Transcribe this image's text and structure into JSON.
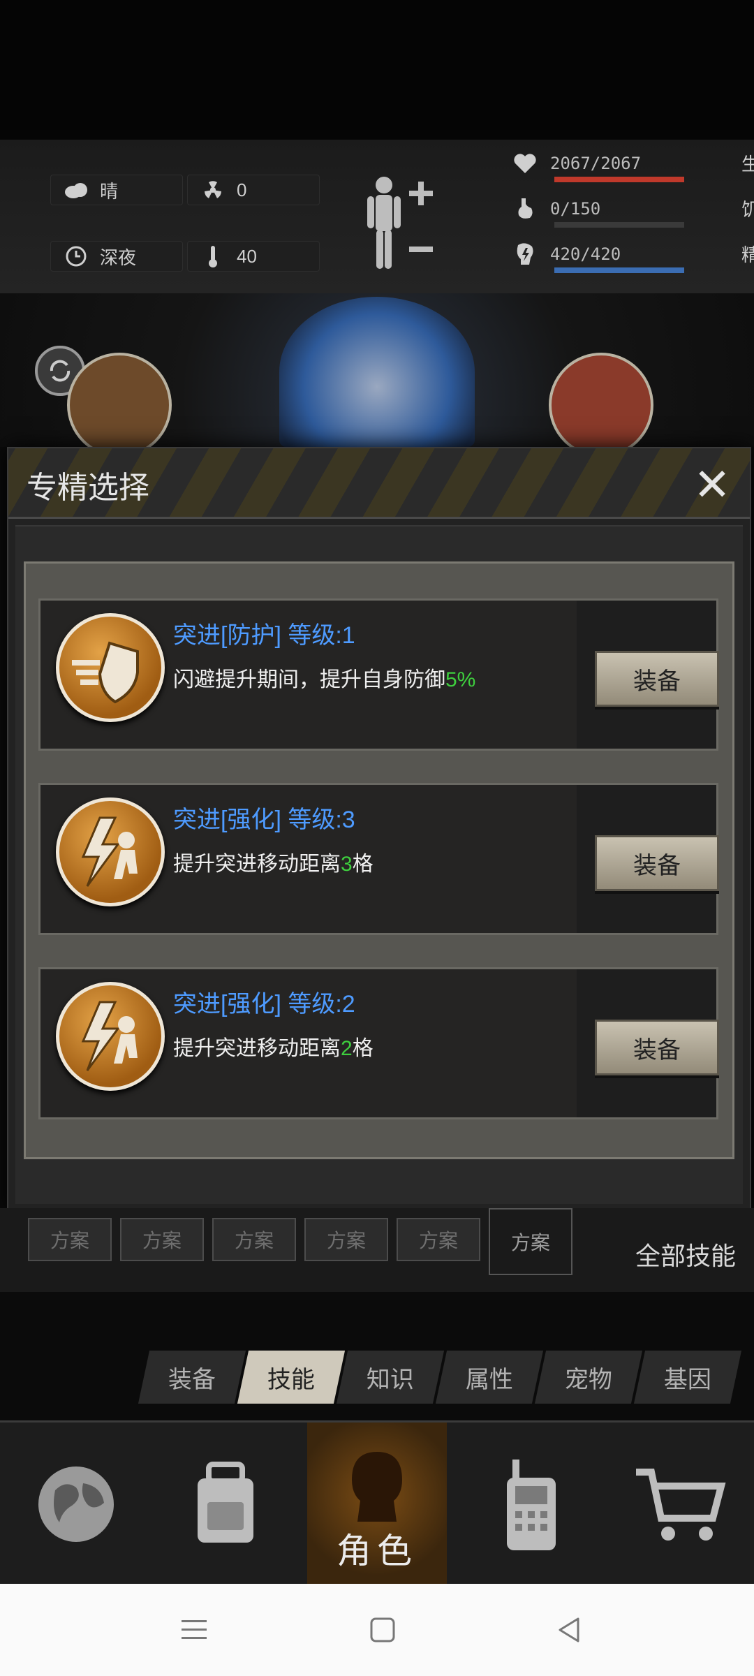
{
  "status": {
    "weather": "晴",
    "radiation": "0",
    "time_of_day": "深夜",
    "temperature": "40",
    "hp": {
      "value": "2067/2067",
      "label": "生命",
      "fill": 1.0,
      "color": "#c0392b"
    },
    "hunger": {
      "value": "0/150",
      "label": "饥饿",
      "fill": 0.0,
      "color": "#777777"
    },
    "energy": {
      "value": "420/420",
      "label": "精力",
      "fill": 1.0,
      "color": "#3b6db3"
    }
  },
  "modal": {
    "title": "专精选择",
    "close_symbol": "✕",
    "cards": [
      {
        "title": "突进[防护] 等级:1",
        "desc_pre": "闪避提升期间，提升自身防御",
        "desc_highlight": "5%",
        "desc_post": "",
        "button": "装备",
        "icon": "dash-shield-icon"
      },
      {
        "title": "突进[强化] 等级:3",
        "desc_pre": "提升突进移动距离",
        "desc_highlight": "3",
        "desc_post": "格",
        "button": "装备",
        "icon": "dash-lightning-icon"
      },
      {
        "title": "突进[强化] 等级:2",
        "desc_pre": "提升突进移动距离",
        "desc_highlight": "2",
        "desc_post": "格",
        "button": "装备",
        "icon": "dash-lightning-icon"
      }
    ]
  },
  "plans": {
    "labels": [
      "方案",
      "方案",
      "方案",
      "方案",
      "方案",
      "方案"
    ],
    "all_skills": "全部技能"
  },
  "tabs": [
    "装备",
    "技能",
    "知识",
    "属性",
    "宠物",
    "基因"
  ],
  "active_tab": "技能",
  "nav": {
    "items": [
      "globe-icon",
      "backpack-icon",
      "character-icon",
      "walkie-talkie-icon",
      "cart-icon"
    ],
    "active_label": "角色"
  }
}
